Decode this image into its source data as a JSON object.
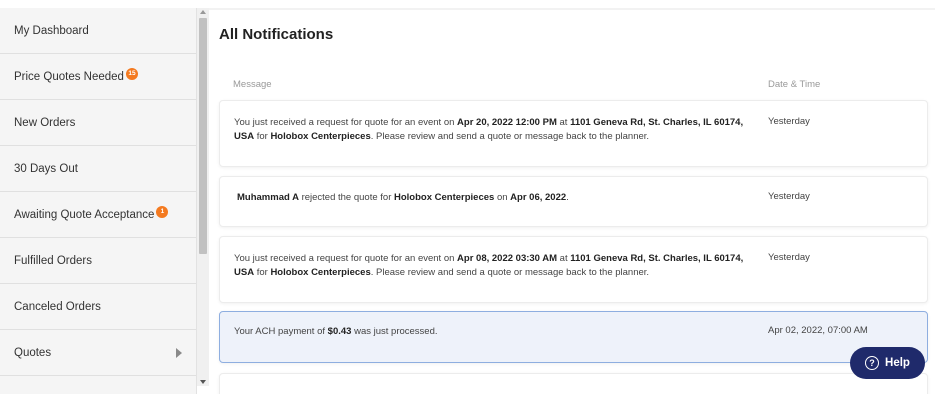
{
  "sidebar": {
    "items": [
      {
        "label": "My Dashboard"
      },
      {
        "label": "Price Quotes Needed",
        "badge": "15"
      },
      {
        "label": "New Orders"
      },
      {
        "label": "30 Days Out"
      },
      {
        "label": "Awaiting Quote Acceptance",
        "badge": "1"
      },
      {
        "label": "Fulfilled Orders"
      },
      {
        "label": "Canceled Orders"
      },
      {
        "label": "Quotes"
      }
    ]
  },
  "main": {
    "title": "All Notifications",
    "columns": {
      "message": "Message",
      "date": "Date & Time"
    },
    "notifications": [
      {
        "parts": [
          {
            "t": "You just received a request for quote for an event on "
          },
          {
            "t": "Apr 20, 2022 12:00 PM",
            "b": true
          },
          {
            "t": " at "
          },
          {
            "t": "1101 Geneva Rd, St. Charles, IL 60174, USA",
            "b": true
          },
          {
            "t": " for "
          },
          {
            "t": "Holobox Centerpieces",
            "b": true
          },
          {
            "t": ". Please review and send a quote or message back to the planner."
          }
        ],
        "date": "Yesterday"
      },
      {
        "parts": [
          {
            "t": "Muhammad A",
            "b": true
          },
          {
            "t": " rejected the quote for  "
          },
          {
            "t": "Holobox Centerpieces",
            "b": true
          },
          {
            "t": " on "
          },
          {
            "t": "Apr 06, 2022",
            "b": true
          },
          {
            "t": "."
          }
        ],
        "date": "Yesterday"
      },
      {
        "parts": [
          {
            "t": "You just received a request for quote for an event on "
          },
          {
            "t": "Apr 08, 2022 03:30 AM",
            "b": true
          },
          {
            "t": " at "
          },
          {
            "t": "1101 Geneva Rd, St. Charles, IL 60174, USA",
            "b": true
          },
          {
            "t": " for "
          },
          {
            "t": "Holobox Centerpieces",
            "b": true
          },
          {
            "t": ". Please review and send a quote or message back to the planner."
          }
        ],
        "date": "Yesterday"
      },
      {
        "parts": [
          {
            "t": "Your ACH payment of "
          },
          {
            "t": "$0.43",
            "b": true
          },
          {
            "t": " was just processed."
          }
        ],
        "date": "Apr 02, 2022, 07:00 AM"
      }
    ]
  },
  "help": {
    "label": "Help",
    "icon": "question-circle-icon"
  },
  "colors": {
    "badge": "#f47a20",
    "help_bg": "#1f2a6b",
    "highlight_border": "#8eaee0",
    "highlight_bg": "#eef2fa"
  }
}
